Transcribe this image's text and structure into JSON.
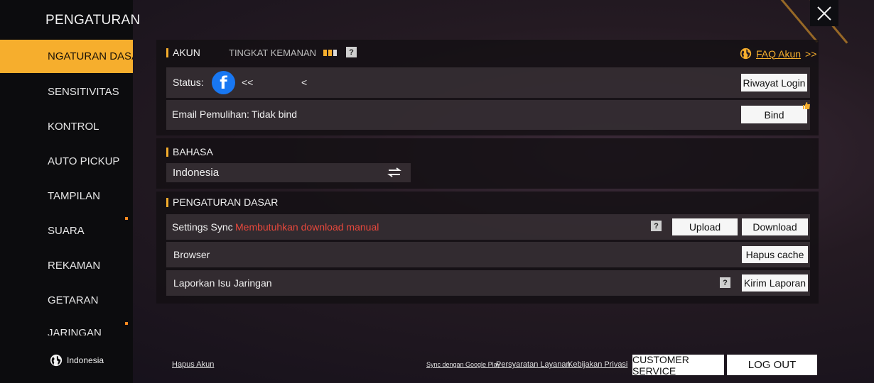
{
  "sidebar": {
    "title": "PENGATURAN",
    "items": [
      {
        "label": "NGATURAN DASA"
      },
      {
        "label": "SENSITIVITAS"
      },
      {
        "label": "KONTROL"
      },
      {
        "label": "AUTO PICKUP"
      },
      {
        "label": "TAMPILAN"
      },
      {
        "label": "SUARA"
      },
      {
        "label": "REKAMAN"
      },
      {
        "label": "GETARAN"
      },
      {
        "label": "JARINGAN"
      }
    ],
    "language": "Indonesia"
  },
  "account": {
    "header": "AKUN",
    "security_label": "TINGKAT KEMANAN",
    "security_level": 2,
    "security_max": 3,
    "faq_label": "FAQ Akun",
    "faq_arrow": ">>",
    "status_label": "Status:",
    "status_value_1": "<<",
    "status_value_2": "<",
    "login_history_button": "Riwayat Login",
    "email_label": "Email Pemulihan:",
    "email_value": "Tidak bind",
    "bind_button": "Bind"
  },
  "language_section": {
    "header": "BAHASA",
    "selected": "Indonesia"
  },
  "basic_settings": {
    "header": "PENGATURAN DASAR",
    "sync_label": "Settings Sync",
    "sync_warning": "Membutuhkan download manual",
    "upload_button": "Upload",
    "download_button": "Download",
    "browser_label": "Browser",
    "clear_cache_button": "Hapus cache",
    "report_label": "Laporkan Isu Jaringan",
    "report_button": "Kirim Laporan"
  },
  "footer": {
    "delete_account": "Hapus Akun",
    "sync_google": "Sync dengan Google Play",
    "terms": "Persyaratan Layanan",
    "privacy": "Kebijakan Privasi",
    "customer_service": "CUSTOMER SERVICE",
    "logout": "LOG OUT"
  },
  "colors": {
    "accent": "#f6ae2d",
    "warning": "#e8483c",
    "facebook": "#1877f2"
  }
}
